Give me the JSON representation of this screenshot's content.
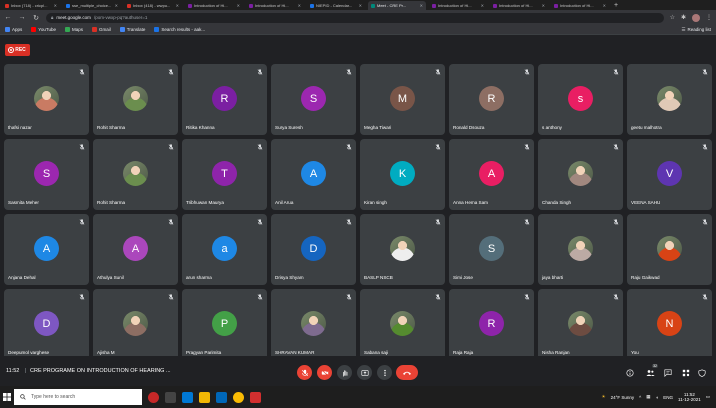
{
  "browser": {
    "tabs": [
      {
        "title": "Inbox (718) - cricpl...",
        "color": "#d93025",
        "active": false
      },
      {
        "title": "sse_multiple_choice...",
        "color": "#1a73e8",
        "active": false
      },
      {
        "title": "Inbox (418) - wwpu...",
        "color": "#d93025",
        "active": false
      },
      {
        "title": "Introduction of Hi...",
        "color": "#7b1fa2",
        "active": false
      },
      {
        "title": "Introduction of Hi...",
        "color": "#7b1fa2",
        "active": false
      },
      {
        "title": "NIEPID - Calendar...",
        "color": "#1a73e8",
        "active": false
      },
      {
        "title": "Meet - CRE Pr...",
        "color": "#00897b",
        "active": true
      },
      {
        "title": "Introduction of Hi...",
        "color": "#7b1fa2",
        "active": false
      },
      {
        "title": "Introduction of Hi...",
        "color": "#7b1fa2",
        "active": false
      },
      {
        "title": "Introduction of Hi...",
        "color": "#7b1fa2",
        "active": false
      }
    ],
    "new_tab": "+",
    "url_host": "meet.google.com",
    "url_path": "/pom-vwxp-pq?authuser=1",
    "bookmarks": [
      {
        "label": "Apps",
        "color": "#4285f4"
      },
      {
        "label": "YouTube",
        "color": "#ff0000"
      },
      {
        "label": "Maps",
        "color": "#34a853"
      },
      {
        "label": "Gmail",
        "color": "#d93025"
      },
      {
        "label": "Translate",
        "color": "#4285f4"
      },
      {
        "label": "Search results - aak...",
        "color": "#1a73e8"
      }
    ],
    "reading_list": "Reading list"
  },
  "meet": {
    "rec_label": "REC",
    "participants": [
      {
        "name": "thafsi nazar",
        "initial": "",
        "color": "#c97b63",
        "photo": true
      },
      {
        "name": "Rohit Sharma",
        "initial": "",
        "color": "#6b8e4e",
        "photo": true
      },
      {
        "name": "Ritika Khanna",
        "initial": "R",
        "color": "#7b1fa2",
        "photo": false
      },
      {
        "name": "Surya Suresh",
        "initial": "S",
        "color": "#9c27b0",
        "photo": false
      },
      {
        "name": "Megha Tiwari",
        "initial": "M",
        "color": "#795548",
        "photo": false
      },
      {
        "name": "Ronald Dsouza",
        "initial": "R",
        "color": "#8d6e63",
        "photo": false
      },
      {
        "name": "s anthony",
        "initial": "s",
        "color": "#e91e63",
        "photo": false
      },
      {
        "name": "geetu malhotra",
        "initial": "",
        "color": "#e0c9b6",
        "photo": true
      },
      {
        "name": "Sasmita Meher",
        "initial": "S",
        "color": "#9c27b0",
        "photo": false
      },
      {
        "name": "Rohit Sharma",
        "initial": "",
        "color": "#6b8e4e",
        "photo": true
      },
      {
        "name": "Tribhuwan Maurya",
        "initial": "T",
        "color": "#8e24aa",
        "photo": false
      },
      {
        "name": "Anil Arua",
        "initial": "A",
        "color": "#1e88e5",
        "photo": false
      },
      {
        "name": "Kiran singh",
        "initial": "K",
        "color": "#00acc1",
        "photo": false
      },
      {
        "name": "Anna Hema Sam",
        "initial": "A",
        "color": "#e91e63",
        "photo": false
      },
      {
        "name": "Chanda Singh",
        "initial": "",
        "color": "#a1887f",
        "photo": true
      },
      {
        "name": "VEENA SAHU",
        "initial": "V",
        "color": "#5e35b1",
        "photo": false
      },
      {
        "name": "Anjana Dehal",
        "initial": "A",
        "color": "#1e88e5",
        "photo": false
      },
      {
        "name": "Athulya Sunil",
        "initial": "A",
        "color": "#ab47bc",
        "photo": false
      },
      {
        "name": "arun sharma",
        "initial": "a",
        "color": "#1e88e5",
        "photo": false
      },
      {
        "name": "Drisya Shyam",
        "initial": "D",
        "color": "#1565c0",
        "photo": false
      },
      {
        "name": "BASLP NSCB",
        "initial": "",
        "color": "#eeeeee",
        "photo": true
      },
      {
        "name": "Simi Jose",
        "initial": "S",
        "color": "#546e7a",
        "photo": false
      },
      {
        "name": "jaya bharti",
        "initial": "",
        "color": "#bcaaa4",
        "photo": true
      },
      {
        "name": "Raju Gaikwad",
        "initial": "",
        "color": "#d84315",
        "photo": true
      },
      {
        "name": "Deepumol varghese",
        "initial": "D",
        "color": "#7e57c2",
        "photo": false
      },
      {
        "name": "Ajisha M",
        "initial": "",
        "color": "#8d6e63",
        "photo": true
      },
      {
        "name": "Pragyan Parimita",
        "initial": "P",
        "color": "#43a047",
        "photo": false
      },
      {
        "name": "SHRAVAN KUMAR",
        "initial": "",
        "color": "#7e6b8f",
        "photo": true
      },
      {
        "name": "Sabana saji",
        "initial": "",
        "color": "#558b2f",
        "photo": true
      },
      {
        "name": "Raja Raja",
        "initial": "R",
        "color": "#8e24aa",
        "photo": false
      },
      {
        "name": "Nisha Ranjan",
        "initial": "",
        "color": "#6d4c41",
        "photo": true
      },
      {
        "name": "You",
        "initial": "N",
        "color": "#d84315",
        "photo": false
      }
    ],
    "time": "11:52",
    "separator": "|",
    "meeting_title": "CRE PROGRAME ON INTRODUCTION OF HEARING ...",
    "participant_count": "32"
  },
  "taskbar": {
    "search_placeholder": "Type here to search",
    "weather": "24°F  Sunny",
    "language": "ENG",
    "clock_time": "11:52",
    "clock_date": "11-12-2021"
  },
  "colors": {
    "meet_bg": "#202124",
    "tile_bg": "#3c4043",
    "danger": "#ea4335"
  }
}
